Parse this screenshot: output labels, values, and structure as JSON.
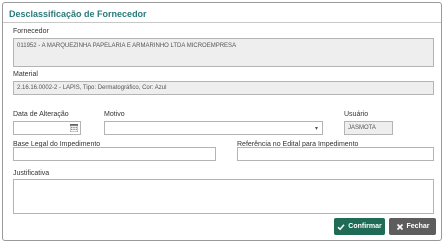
{
  "dialog": {
    "title": "Desclassificação de Fornecedor"
  },
  "fields": {
    "fornecedor": {
      "label": "Fornecedor",
      "value": "011952 - A MARQUEZINHA PAPELARIA E ARMARINHO LTDA MICROEMPRESA"
    },
    "material": {
      "label": "Material",
      "value": "2.16.16.0002-2 - LAPIS, Tipo: Dermatográfico, Cor: Azul"
    },
    "data_alteracao": {
      "label": "Data de Alteração",
      "value": ""
    },
    "motivo": {
      "label": "Motivo",
      "value": ""
    },
    "usuario": {
      "label": "Usuário",
      "value": "JASMOTA"
    },
    "base_legal": {
      "label": "Base Legal do Impedimento",
      "value": ""
    },
    "referencia_edital": {
      "label": "Referência no Edital para Impedimento",
      "value": ""
    },
    "justificativa": {
      "label": "Justificativa",
      "value": ""
    }
  },
  "buttons": {
    "confirm": "Confirmar",
    "close": "Fechar"
  },
  "icons": {
    "calendar": "calendar-icon",
    "dropdown": "chevron-down-icon",
    "confirm": "check-icon",
    "close": "close-icon"
  },
  "colors": {
    "title": "#2a7a7a",
    "confirm_button": "#1f6b55",
    "close_button": "#5d5d5d"
  }
}
